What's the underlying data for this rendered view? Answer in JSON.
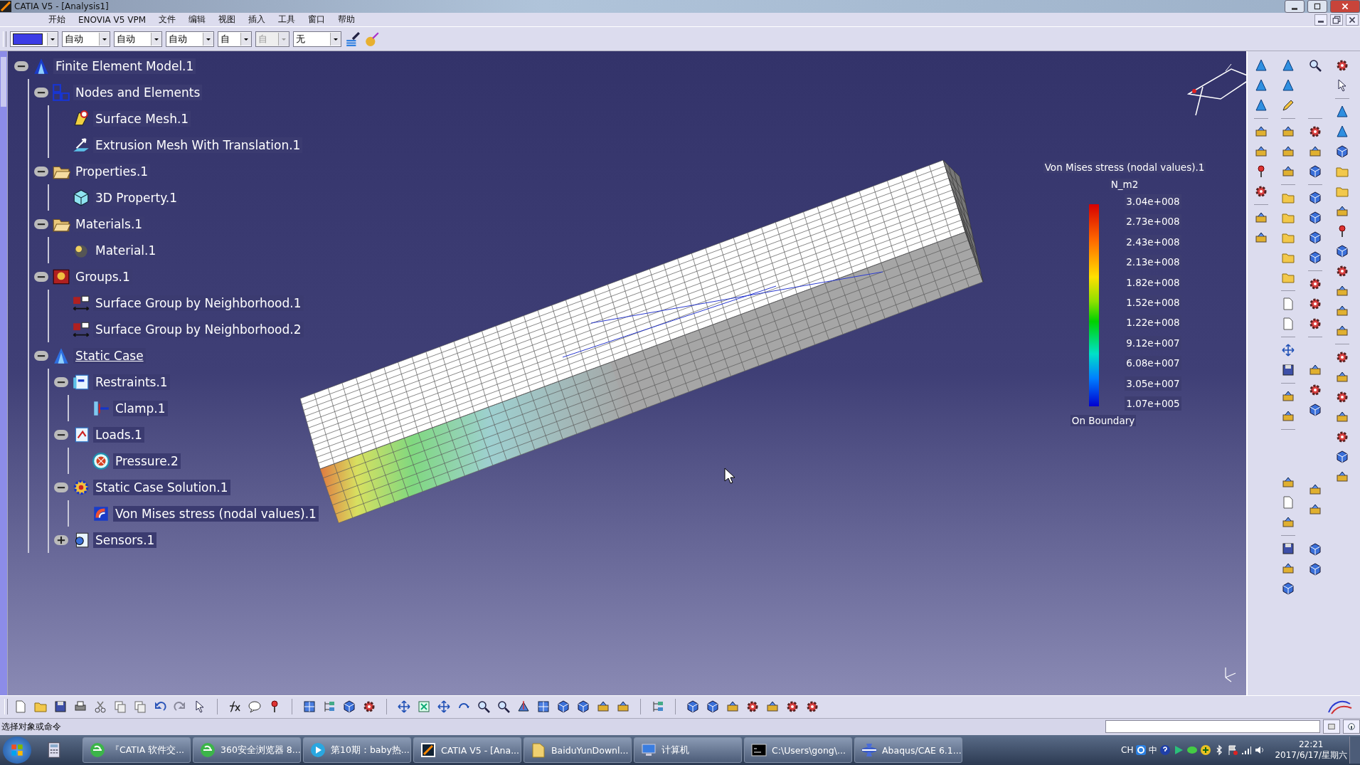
{
  "window": {
    "title": "CATIA V5 - [Analysis1]"
  },
  "menu": [
    "开始",
    "ENOVIA V5 VPM",
    "文件",
    "编辑",
    "视图",
    "插入",
    "工具",
    "窗口",
    "帮助"
  ],
  "toolbar": {
    "dropdowns": [
      {
        "kind": "color",
        "color": "#3c3ce6",
        "disabled": false
      },
      {
        "kind": "text",
        "value": "自动",
        "disabled": false
      },
      {
        "kind": "text",
        "value": "自动",
        "disabled": false
      },
      {
        "kind": "text",
        "value": "自动",
        "disabled": false
      },
      {
        "kind": "text",
        "value": "自",
        "disabled": false
      },
      {
        "kind": "text",
        "value": "自",
        "disabled": true
      },
      {
        "kind": "text",
        "value": "无",
        "disabled": false
      }
    ]
  },
  "tree": [
    {
      "label": "Finite Element Model.1",
      "kind": "model",
      "current": false,
      "expanded": true,
      "children": [
        {
          "label": "Nodes and Elements",
          "kind": "nodes",
          "current": false,
          "expanded": true,
          "children": [
            {
              "label": "Surface Mesh.1",
              "kind": "mesh",
              "current": false
            },
            {
              "label": "Extrusion Mesh With Translation.1",
              "kind": "extrusion",
              "current": false
            }
          ]
        },
        {
          "label": "Properties.1",
          "kind": "folder",
          "current": false,
          "expanded": true,
          "children": [
            {
              "label": "3D Property.1",
              "kind": "property",
              "current": false
            }
          ]
        },
        {
          "label": "Materials.1",
          "kind": "folder",
          "current": false,
          "expanded": true,
          "children": [
            {
              "label": "Material.1",
              "kind": "material",
              "current": false
            }
          ]
        },
        {
          "label": "Groups.1",
          "kind": "groups",
          "current": false,
          "expanded": true,
          "children": [
            {
              "label": "Surface Group by Neighborhood.1",
              "kind": "group",
              "current": false
            },
            {
              "label": "Surface Group by Neighborhood.2",
              "kind": "group",
              "current": false
            }
          ]
        },
        {
          "label": "Static Case",
          "kind": "case",
          "current": true,
          "expanded": true,
          "children": [
            {
              "label": "Restraints.1",
              "kind": "restraints",
              "current": false,
              "expanded": true,
              "children": [
                {
                  "label": "Clamp.1",
                  "kind": "clamp",
                  "current": false
                }
              ]
            },
            {
              "label": "Loads.1",
              "kind": "loads",
              "current": false,
              "expanded": true,
              "children": [
                {
                  "label": "Pressure.2",
                  "kind": "pressure",
                  "current": false
                }
              ]
            },
            {
              "label": "Static Case Solution.1",
              "kind": "solution",
              "current": false,
              "expanded": true,
              "children": [
                {
                  "label": "Von Mises stress (nodal values).1",
                  "kind": "image",
                  "current": false
                }
              ]
            },
            {
              "label": "Sensors.1",
              "kind": "sensors",
              "current": false,
              "expanded": false
            }
          ]
        }
      ]
    }
  ],
  "legend": {
    "title": "Von Mises stress (nodal values).1",
    "unit": "N_m2",
    "values": [
      "3.04e+008",
      "2.73e+008",
      "2.43e+008",
      "2.13e+008",
      "1.82e+008",
      "1.52e+008",
      "1.22e+008",
      "9.12e+007",
      "6.08e+007",
      "3.05e+007",
      "1.07e+005"
    ],
    "footer": "On Boundary"
  },
  "status_bar": {
    "prompt": "选择对象或命令"
  },
  "taskbar": {
    "buttons": [
      {
        "label": "『CATIA 软件交...",
        "kind": "browser"
      },
      {
        "label": "360安全浏览器 8...",
        "kind": "browser"
      },
      {
        "label": "第10期：baby热...",
        "kind": "video"
      },
      {
        "label": "CATIA V5 - [Ana...",
        "kind": "catia"
      },
      {
        "label": "BaiduYunDownl...",
        "kind": "folder"
      },
      {
        "label": "计算机",
        "kind": "computer"
      },
      {
        "label": "C:\\Users\\gong\\...",
        "kind": "terminal"
      },
      {
        "label": "Abaqus/CAE 6.1...",
        "kind": "abaqus"
      }
    ],
    "tray": {
      "language": "CH",
      "ime": "中",
      "time": "22:21",
      "date": "2017/6/17/星期六"
    }
  }
}
